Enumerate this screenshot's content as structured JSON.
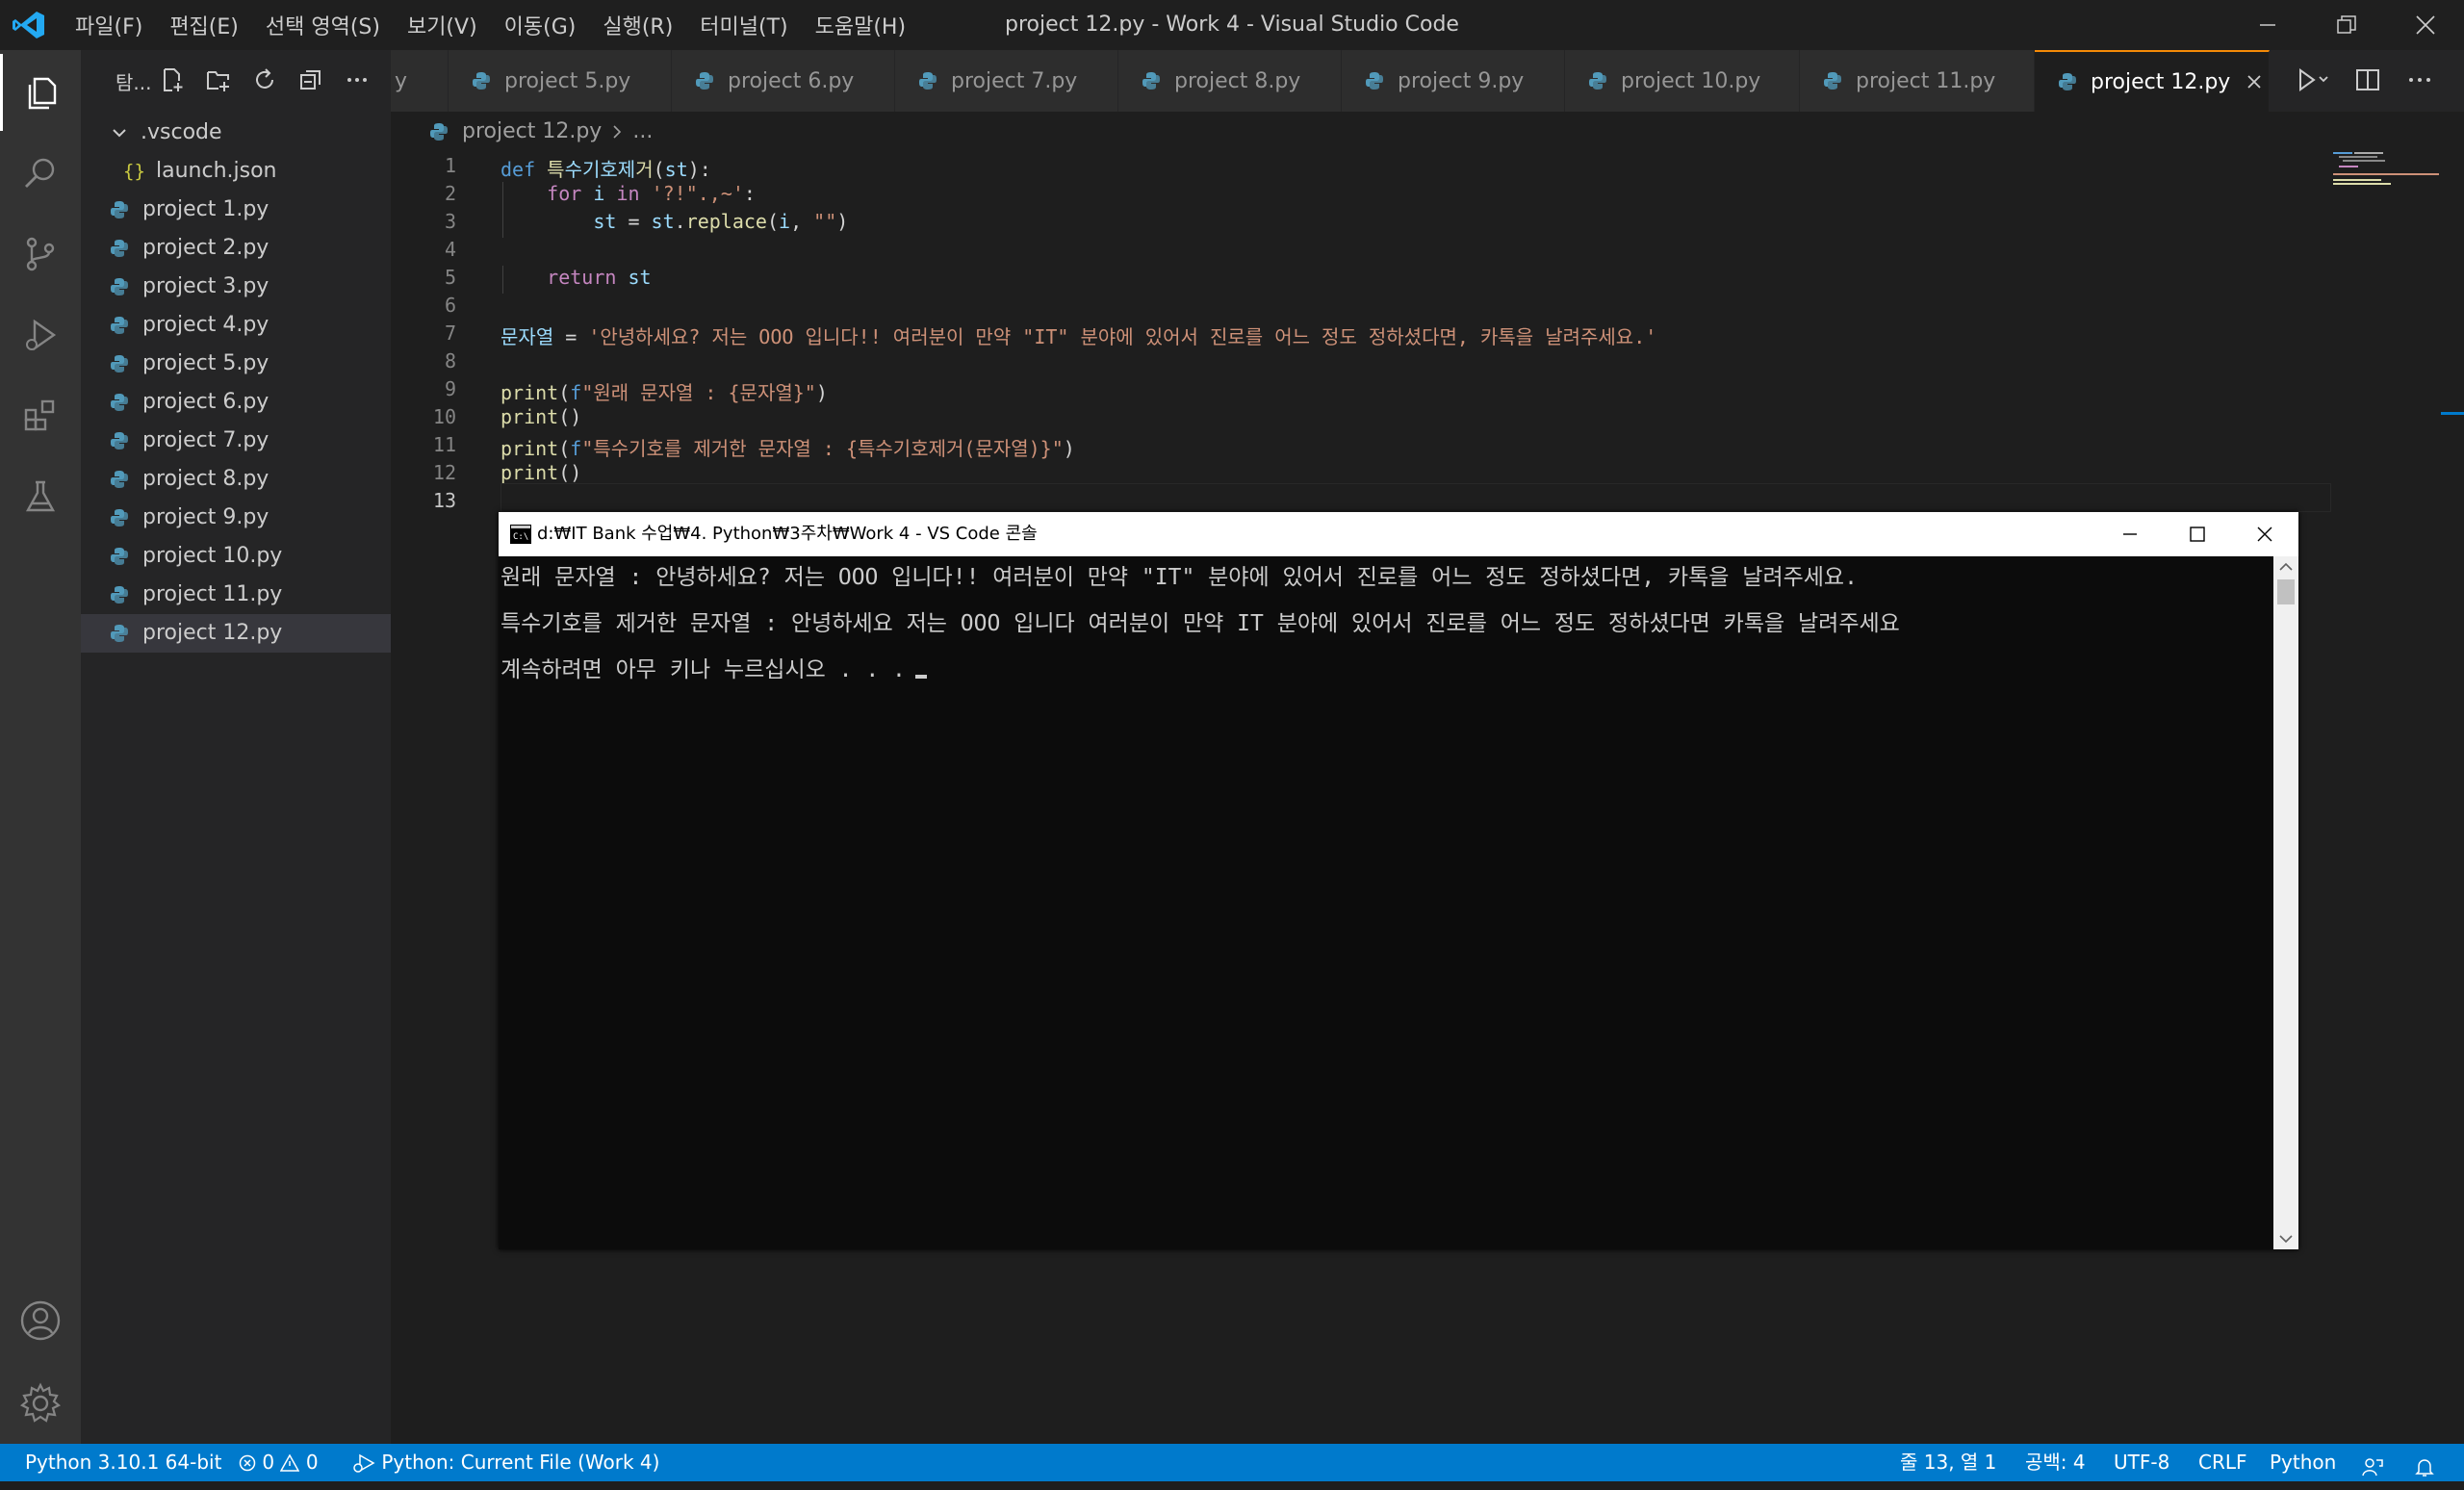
{
  "window": {
    "title": "project 12.py - Work 4 - Visual Studio Code",
    "menu": [
      "파일(F)",
      "편집(E)",
      "선택 영역(S)",
      "보기(V)",
      "이동(G)",
      "실행(R)",
      "터미널(T)",
      "도움말(H)"
    ]
  },
  "activity_bar": {
    "items": [
      "explorer-icon",
      "search-icon",
      "source-control-icon",
      "run-debug-icon",
      "extensions-icon",
      "testing-icon"
    ],
    "bottom": [
      "account-icon",
      "settings-gear-icon"
    ]
  },
  "sidebar": {
    "title": "탐...",
    "folder": ".vscode",
    "folder_child": "launch.json",
    "files": [
      "project 1.py",
      "project 2.py",
      "project 3.py",
      "project 4.py",
      "project 5.py",
      "project 6.py",
      "project 7.py",
      "project 8.py",
      "project 9.py",
      "project 10.py",
      "project 11.py",
      "project 12.py"
    ],
    "selected": "project 12.py"
  },
  "tabs": {
    "items": [
      "project 5.py",
      "project 6.py",
      "project 7.py",
      "project 8.py",
      "project 9.py",
      "project 10.py",
      "project 11.py",
      "project 12.py"
    ],
    "active": "project 12.py",
    "partial": "y"
  },
  "breadcrumb": {
    "file": "project 12.py",
    "rest": "..."
  },
  "editor": {
    "line_numbers": [
      "1",
      "2",
      "3",
      "4",
      "5",
      "6",
      "7",
      "8",
      "9",
      "10",
      "11",
      "12",
      "13"
    ],
    "lines": [
      "def 특수기호제거(st):",
      "    for i in '?!\".,~':",
      "        st = st.replace(i, \"\")",
      "",
      "    return st",
      "",
      "문자열 = '안녕하세요? 저는 OOO 입니다!! 여러분이 만약 \"IT\" 분야에 있어서 진로를 어느 정도 정하셨다면, 카톡을 날려주세요.'",
      "",
      "print(f\"원래 문자열 : {문자열}\")",
      "print()",
      "print(f\"특수기호를 제거한 문자열 : {특수기호제거(문자열)}\")",
      "print()",
      ""
    ]
  },
  "console": {
    "title": "d:₩IT Bank 수업₩4. Python₩3주차₩Work 4 - VS Code 콘솔",
    "lines": [
      "원래 문자열 : 안녕하세요? 저는 OOO 입니다!! 여러분이 만약 \"IT\" 분야에 있어서 진로를 어느 정도 정하셨다면, 카톡을 날려주세요.",
      "특수기호를 제거한 문자열 : 안녕하세요 저는 OOO 입니다 여러분이 만약 IT 분야에 있어서 진로를 어느 정도 정하셨다면 카톡을 날려주세요",
      "계속하려면 아무 키나 누르십시오 . . ."
    ]
  },
  "statusbar": {
    "interpreter": "Python 3.10.1 64-bit",
    "errors": "0",
    "warnings": "0",
    "run_config": "Python: Current File (Work 4)",
    "position": "줄 13, 열 1",
    "spaces": "공백: 4",
    "encoding": "UTF-8",
    "eol": "CRLF",
    "language": "Python"
  },
  "colors": {
    "accent": "#007acc",
    "active_tab_border": "#f58a07",
    "console_bg": "#0c0c0c"
  }
}
